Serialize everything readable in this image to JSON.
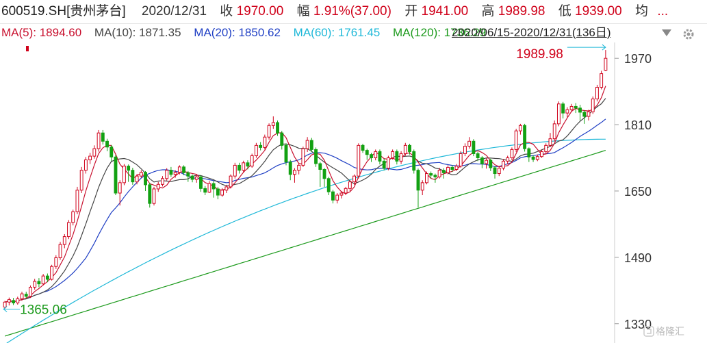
{
  "header": {
    "code_name": "600519.SH[贵州茅台]",
    "date": "2020/12/31",
    "close_label": "收",
    "close_value": "1970.00",
    "change_label": "幅",
    "change_value": "1.91%(37.00)",
    "open_label": "开",
    "open_value": "1941.00",
    "high_label": "高",
    "high_value": "1989.98",
    "low_label": "低",
    "low_value": "1939.00",
    "avg_label": "均",
    "more": "..."
  },
  "ma_bar": {
    "ma5": "MA(5): 1894.60",
    "ma10": "MA(10): 1871.35",
    "ma20": "MA(20): 1850.62",
    "ma60": "MA(60): 1761.45",
    "ma120": "MA(120): 1736.29",
    "range": "2020/06/15-2020/12/31(136日)"
  },
  "watermark": "格隆汇",
  "colors": {
    "up": "#d0021b",
    "down": "#12a112",
    "ma5": "#c8102e",
    "ma10": "#444444",
    "ma20": "#1f3fc4",
    "ma60": "#1eb8d8",
    "ma120": "#1c9a1c",
    "axis": "#cccccc"
  },
  "chart_data": {
    "type": "candlestick",
    "period": "2020/06/15-2020/12/31",
    "count": 136,
    "y_ticks": [
      1330,
      1490,
      1650,
      1810,
      1970
    ],
    "ylim": [
      1290,
      2000
    ],
    "high_label": "1989.98",
    "low_label": "1365.06",
    "candles": [
      [
        1370,
        1382,
        1365.06,
        1385
      ],
      [
        1382,
        1388,
        1374,
        1393
      ],
      [
        1386,
        1380,
        1375,
        1392
      ],
      [
        1380,
        1390,
        1376,
        1395
      ],
      [
        1390,
        1402,
        1385,
        1407
      ],
      [
        1401,
        1396,
        1391,
        1407
      ],
      [
        1396,
        1418,
        1392,
        1422
      ],
      [
        1418,
        1432,
        1412,
        1438
      ],
      [
        1432,
        1426,
        1418,
        1440
      ],
      [
        1426,
        1445,
        1422,
        1450
      ],
      [
        1445,
        1437,
        1430,
        1451
      ],
      [
        1437,
        1468,
        1434,
        1472
      ],
      [
        1468,
        1489,
        1462,
        1495
      ],
      [
        1489,
        1521,
        1484,
        1527
      ],
      [
        1521,
        1540,
        1512,
        1546
      ],
      [
        1540,
        1574,
        1534,
        1580
      ],
      [
        1574,
        1600,
        1567,
        1605
      ],
      [
        1600,
        1652,
        1594,
        1660
      ],
      [
        1652,
        1700,
        1645,
        1708
      ],
      [
        1700,
        1725,
        1692,
        1732
      ],
      [
        1725,
        1734,
        1715,
        1742
      ],
      [
        1734,
        1752,
        1728,
        1760
      ],
      [
        1752,
        1790,
        1745,
        1797
      ],
      [
        1790,
        1770,
        1762,
        1797
      ],
      [
        1770,
        1756,
        1746,
        1776
      ],
      [
        1756,
        1732,
        1722,
        1761
      ],
      [
        1732,
        1645,
        1640,
        1737
      ],
      [
        1645,
        1670,
        1615,
        1676
      ],
      [
        1670,
        1710,
        1664,
        1715
      ],
      [
        1710,
        1700,
        1672,
        1714
      ],
      [
        1700,
        1672,
        1665,
        1706
      ],
      [
        1672,
        1686,
        1666,
        1691
      ],
      [
        1686,
        1695,
        1682,
        1700
      ],
      [
        1695,
        1665,
        1650,
        1698
      ],
      [
        1665,
        1620,
        1610,
        1670
      ],
      [
        1620,
        1655,
        1615,
        1660
      ],
      [
        1655,
        1666,
        1648,
        1672
      ],
      [
        1666,
        1680,
        1661,
        1686
      ],
      [
        1680,
        1700,
        1675,
        1705
      ],
      [
        1700,
        1690,
        1684,
        1708
      ],
      [
        1690,
        1695,
        1682,
        1700
      ],
      [
        1695,
        1708,
        1690,
        1712
      ],
      [
        1708,
        1694,
        1688,
        1712
      ],
      [
        1694,
        1686,
        1672,
        1698
      ],
      [
        1686,
        1678,
        1671,
        1690
      ],
      [
        1678,
        1684,
        1670,
        1689
      ],
      [
        1684,
        1656,
        1648,
        1688
      ],
      [
        1656,
        1647,
        1640,
        1662
      ],
      [
        1647,
        1668,
        1645,
        1674
      ],
      [
        1668,
        1655,
        1634,
        1674
      ],
      [
        1655,
        1640,
        1630,
        1660
      ],
      [
        1640,
        1652,
        1636,
        1657
      ],
      [
        1652,
        1660,
        1645,
        1665
      ],
      [
        1660,
        1686,
        1656,
        1690
      ],
      [
        1686,
        1712,
        1680,
        1718
      ],
      [
        1712,
        1700,
        1692,
        1718
      ],
      [
        1700,
        1718,
        1694,
        1723
      ],
      [
        1718,
        1710,
        1702,
        1724
      ],
      [
        1710,
        1735,
        1706,
        1740
      ],
      [
        1735,
        1760,
        1730,
        1766
      ],
      [
        1760,
        1755,
        1748,
        1768
      ],
      [
        1755,
        1780,
        1750,
        1786
      ],
      [
        1780,
        1808,
        1774,
        1813
      ],
      [
        1808,
        1815,
        1800,
        1830
      ],
      [
        1815,
        1790,
        1783,
        1820
      ],
      [
        1790,
        1760,
        1750,
        1795
      ],
      [
        1760,
        1720,
        1712,
        1765
      ],
      [
        1720,
        1690,
        1676,
        1725
      ],
      [
        1690,
        1700,
        1670,
        1705
      ],
      [
        1700,
        1712,
        1690,
        1718
      ],
      [
        1712,
        1752,
        1708,
        1757
      ],
      [
        1752,
        1772,
        1744,
        1780
      ],
      [
        1772,
        1750,
        1744,
        1778
      ],
      [
        1750,
        1716,
        1708,
        1755
      ],
      [
        1716,
        1702,
        1660,
        1720
      ],
      [
        1702,
        1680,
        1660,
        1705
      ],
      [
        1680,
        1648,
        1640,
        1684
      ],
      [
        1648,
        1628,
        1620,
        1653
      ],
      [
        1628,
        1640,
        1620,
        1645
      ],
      [
        1640,
        1645,
        1632,
        1650
      ],
      [
        1645,
        1656,
        1640,
        1660
      ],
      [
        1656,
        1672,
        1650,
        1676
      ],
      [
        1672,
        1686,
        1665,
        1690
      ],
      [
        1686,
        1760,
        1680,
        1765
      ],
      [
        1760,
        1748,
        1742,
        1764
      ],
      [
        1748,
        1738,
        1725,
        1752
      ],
      [
        1738,
        1730,
        1720,
        1742
      ],
      [
        1730,
        1745,
        1724,
        1750
      ],
      [
        1745,
        1722,
        1714,
        1750
      ],
      [
        1722,
        1705,
        1700,
        1728
      ],
      [
        1705,
        1730,
        1700,
        1735
      ],
      [
        1730,
        1745,
        1726,
        1750
      ],
      [
        1745,
        1722,
        1714,
        1750
      ],
      [
        1722,
        1740,
        1715,
        1746
      ],
      [
        1740,
        1760,
        1735,
        1766
      ],
      [
        1760,
        1745,
        1738,
        1764
      ],
      [
        1745,
        1700,
        1692,
        1750
      ],
      [
        1700,
        1652,
        1610,
        1704
      ],
      [
        1652,
        1670,
        1640,
        1676
      ],
      [
        1670,
        1692,
        1666,
        1697
      ],
      [
        1692,
        1688,
        1680,
        1697
      ],
      [
        1688,
        1684,
        1670,
        1692
      ],
      [
        1684,
        1700,
        1680,
        1706
      ],
      [
        1700,
        1694,
        1680,
        1705
      ],
      [
        1694,
        1707,
        1690,
        1712
      ],
      [
        1707,
        1702,
        1696,
        1712
      ],
      [
        1702,
        1710,
        1698,
        1715
      ],
      [
        1710,
        1740,
        1706,
        1746
      ],
      [
        1740,
        1758,
        1734,
        1765
      ],
      [
        1758,
        1770,
        1752,
        1780
      ],
      [
        1770,
        1740,
        1734,
        1775
      ],
      [
        1740,
        1730,
        1722,
        1745
      ],
      [
        1730,
        1716,
        1705,
        1734
      ],
      [
        1716,
        1724,
        1704,
        1729
      ],
      [
        1724,
        1706,
        1698,
        1728
      ],
      [
        1706,
        1692,
        1680,
        1710
      ],
      [
        1692,
        1705,
        1686,
        1710
      ],
      [
        1705,
        1722,
        1700,
        1727
      ],
      [
        1722,
        1730,
        1714,
        1735
      ],
      [
        1730,
        1750,
        1724,
        1755
      ],
      [
        1750,
        1795,
        1744,
        1800
      ],
      [
        1795,
        1808,
        1786,
        1812
      ],
      [
        1808,
        1752,
        1745,
        1812
      ],
      [
        1752,
        1732,
        1720,
        1755
      ],
      [
        1732,
        1726,
        1720,
        1736
      ],
      [
        1726,
        1733,
        1722,
        1738
      ],
      [
        1733,
        1745,
        1730,
        1750
      ],
      [
        1745,
        1760,
        1740,
        1765
      ],
      [
        1760,
        1776,
        1756,
        1790
      ],
      [
        1776,
        1812,
        1770,
        1820
      ],
      [
        1812,
        1860,
        1806,
        1866
      ],
      [
        1860,
        1838,
        1825,
        1865
      ],
      [
        1838,
        1846,
        1828,
        1852
      ],
      [
        1846,
        1854,
        1840,
        1860
      ],
      [
        1854,
        1850,
        1838,
        1862
      ],
      [
        1850,
        1840,
        1820,
        1858
      ],
      [
        1840,
        1830,
        1812,
        1845
      ],
      [
        1830,
        1841,
        1820,
        1846
      ],
      [
        1841,
        1872,
        1836,
        1878
      ],
      [
        1872,
        1900,
        1866,
        1906
      ],
      [
        1900,
        1933,
        1895,
        1940
      ],
      [
        1941,
        1970,
        1939,
        1989.98
      ]
    ]
  }
}
